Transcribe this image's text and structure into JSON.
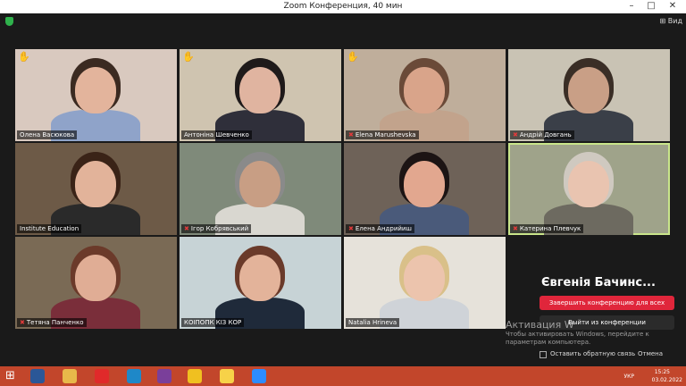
{
  "window": {
    "title": "Zoom Конференция, 40 мин",
    "minimize": "–",
    "maximize": "□",
    "close": "✕"
  },
  "topbar": {
    "view_label": "Вид"
  },
  "participants": [
    {
      "name": "Олена Васюкова",
      "muted": false,
      "hand": true,
      "active": false,
      "bg": "#d9c9bf",
      "skin": "#e3b49c",
      "hair": "#3b2a21",
      "body": "#8fa3c9"
    },
    {
      "name": "Антоніна Шевченко",
      "muted": false,
      "hand": true,
      "active": false,
      "bg": "#cfc4b0",
      "skin": "#e0b4a0",
      "hair": "#1f1a1a",
      "body": "#2f2f3a"
    },
    {
      "name": "Elena Marushevska",
      "muted": true,
      "hand": true,
      "active": false,
      "bg": "#bfae9b",
      "skin": "#d9a48a",
      "hair": "#6a4a38",
      "body": "#c2a38c"
    },
    {
      "name": "Андрій Довгань",
      "muted": true,
      "hand": false,
      "active": false,
      "bg": "#c9c3b4",
      "skin": "#c99f86",
      "hair": "#3a2e26",
      "body": "#3a3f48"
    },
    {
      "name": "Institute Education",
      "muted": false,
      "hand": false,
      "active": false,
      "bg": "#6d5a47",
      "skin": "#e2b39a",
      "hair": "#3a2317",
      "body": "#2a2a2a"
    },
    {
      "name": "Ігор Кобрявський",
      "muted": true,
      "hand": false,
      "active": false,
      "bg": "#7f8a7a",
      "skin": "#c89e84",
      "hair": "#8a8a8a",
      "body": "#d9d7d0"
    },
    {
      "name": "Елена Андрийиш",
      "muted": true,
      "hand": false,
      "active": false,
      "bg": "#6e6258",
      "skin": "#e2a78f",
      "hair": "#1c1414",
      "body": "#4a5a7a"
    },
    {
      "name": "Катерина Плевчук",
      "muted": true,
      "hand": false,
      "active": true,
      "bg": "#9fa38a",
      "skin": "#e9c4b0",
      "hair": "#cfc9c0",
      "body": "#6d6a60"
    },
    {
      "name": "Тетяна Панченко",
      "muted": true,
      "hand": false,
      "active": false,
      "bg": "#7a6a55",
      "skin": "#e0ad95",
      "hair": "#6b3a2a",
      "body": "#7a2e3a"
    },
    {
      "name": "КОІПОПК КІЗ КОР",
      "muted": false,
      "hand": false,
      "active": false,
      "bg": "#c7d3d6",
      "skin": "#e3b39a",
      "hair": "#6a3a2a",
      "body": "#1f2a3a"
    },
    {
      "name": "Natalia Hrineva",
      "muted": false,
      "hand": false,
      "active": false,
      "bg": "#e6e2da",
      "skin": "#ecc4ad",
      "hair": "#d9c089",
      "body": "#cfd3d8"
    }
  ],
  "overlay": {
    "speaker_name": "Євгенія Бачинс...",
    "end_button": "Завершить конференцию для всех",
    "leave_button": "Выйти из конференции"
  },
  "watermark": {
    "line1": "Активация W",
    "line2": "Чтобы активировать Windows, перейдите к",
    "line3": "параметрам компьютера."
  },
  "bottom": {
    "checkbox_label": "Оставить обратную связь",
    "cancel_label": "Отмена"
  },
  "taskbar": {
    "icons": [
      {
        "name": "windows-start-icon",
        "color": "#ffffff"
      },
      {
        "name": "word-icon",
        "color": "#2b5797"
      },
      {
        "name": "file-explorer-icon",
        "color": "#e8b84a"
      },
      {
        "name": "opera-icon",
        "color": "#e02a2a"
      },
      {
        "name": "edge-icon",
        "color": "#1e88c8"
      },
      {
        "name": "winrar-icon",
        "color": "#7a3f9a"
      },
      {
        "name": "chrome-icon",
        "color": "#f0c020"
      },
      {
        "name": "yandex-browser-icon",
        "color": "#f7d248"
      },
      {
        "name": "zoom-icon",
        "color": "#2d8cff"
      }
    ],
    "language": "УКР",
    "time": "15:25",
    "date": "03.02.2022"
  }
}
